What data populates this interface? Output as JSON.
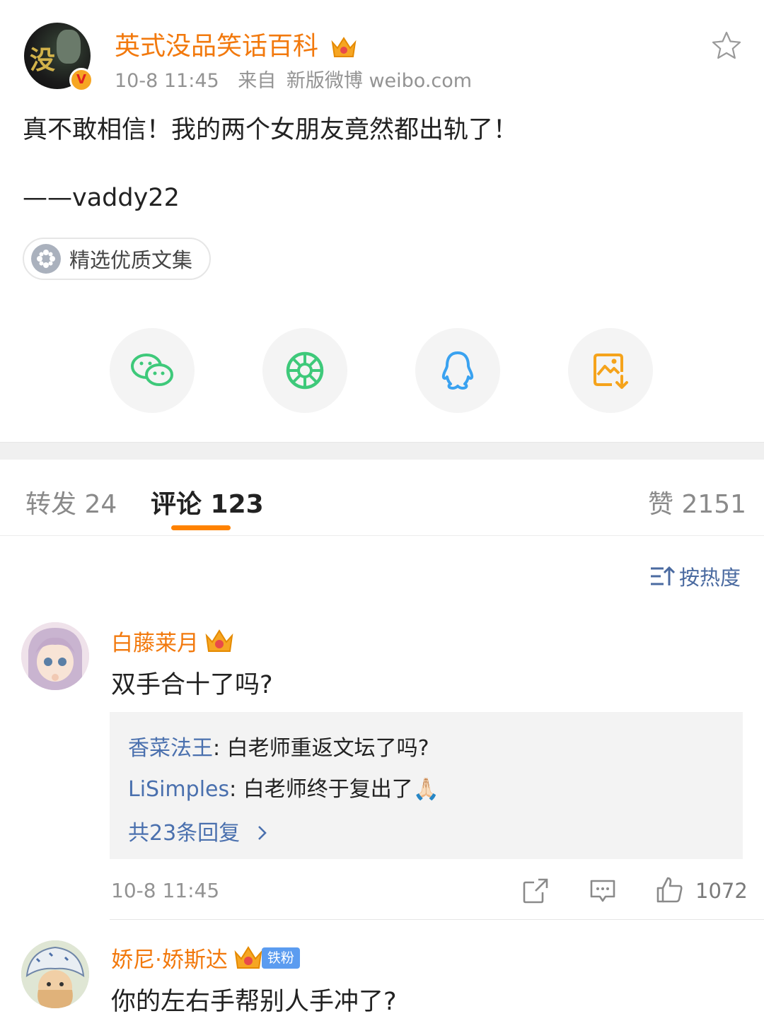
{
  "post": {
    "author": "英式没品笑话百科",
    "time": "10-8 11:45",
    "source_prefix": "来自",
    "source": "新版微博 weibo.com",
    "content": "真不敢相信！我的两个女朋友竟然都出轨了！",
    "signature": "——vaddy22",
    "tag": "精选优质文集",
    "verified_mark": "V",
    "avatar_text": "没"
  },
  "share": [
    {
      "icon": "wechat-icon",
      "color": "#3ec97a"
    },
    {
      "icon": "moments-icon",
      "color": "#3ec97a"
    },
    {
      "icon": "qq-icon",
      "color": "#3aa2f0"
    },
    {
      "icon": "save-image-icon",
      "color": "#f5a31b"
    }
  ],
  "tabs": {
    "repost": "转发 24",
    "comments": "评论 123",
    "likes": "赞 2151"
  },
  "sort_label": "按热度",
  "comments": [
    {
      "name": "白藤莱月",
      "text": "双手合十了吗?",
      "replies": [
        {
          "name": "香菜法王",
          "sep": ": ",
          "text": "白老师重返文坛了吗?"
        },
        {
          "name": "LiSimples",
          "sep": ": ",
          "text": "白老师终于复出了🙏🏻"
        }
      ],
      "more_replies": "共23条回复",
      "time": "10-8 11:45",
      "likes": "1072"
    },
    {
      "name": "娇尼·娇斯达",
      "badge": "铁粉",
      "text": "你的左右手帮别人手冲了?"
    }
  ],
  "colors": {
    "accent": "#ff8200",
    "name": "#f2790d",
    "link": "#4a70ae"
  }
}
